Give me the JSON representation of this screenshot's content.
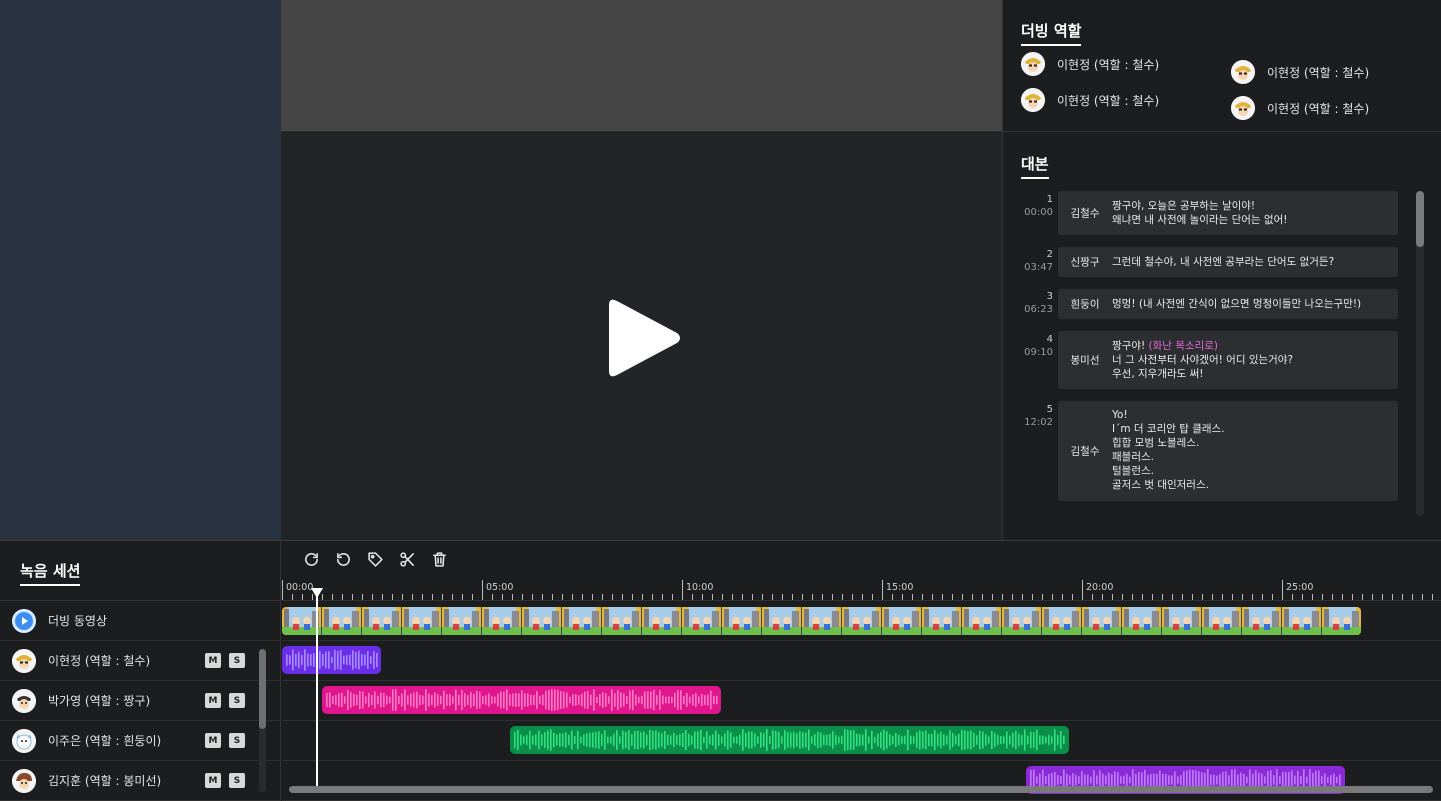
{
  "roles_panel": {
    "title": "더빙 역할",
    "items": [
      {
        "label": "이현정 (역할 : 철수)"
      },
      {
        "label": "이현정 (역할 : 철수)"
      },
      {
        "label": "이현정 (역할 : 철수)"
      },
      {
        "label": "이현정 (역할 : 철수)"
      }
    ]
  },
  "script_panel": {
    "title": "대본",
    "rows": [
      {
        "index": "1",
        "time": "00:00",
        "speaker": "김철수",
        "lines": "짱구야, 오늘은 공부하는 날이야!\n왜냐면 내 사전에 놀이라는 단어는 없어!"
      },
      {
        "index": "2",
        "time": "03:47",
        "speaker": "신짱구",
        "lines": "그런데 철수야, 내 사전엔 공부라는 단어도 없거든?"
      },
      {
        "index": "3",
        "time": "06:23",
        "speaker": "흰둥이",
        "lines": "멍멍! (내 사전엔 간식이 없으면 멍청이들만 나오는구만!)"
      },
      {
        "index": "4",
        "time": "09:10",
        "speaker": "봉미선",
        "line1": "짱구야! ",
        "highlight": "(화난 목소리로)",
        "lines": "너 그 사전부터 사야겠어! 어디 있는거야?\n우선, 지우개라도 써!"
      },
      {
        "index": "5",
        "time": "12:02",
        "speaker": "김철수",
        "lines": "Yo!\nI´m 더 코리안 탑 클래스.\n힙합 모범 노블레스.\n패블러스.\n털블런스.\n골저스 벗 대인저러스."
      }
    ]
  },
  "session": {
    "title": "녹음 세션",
    "tracks": [
      {
        "label": "더빙 동영상"
      },
      {
        "label": "이현정 (역할 : 철수)",
        "mute": "M",
        "solo": "S"
      },
      {
        "label": "박가영 (역할 : 짱구)",
        "mute": "M",
        "solo": "S"
      },
      {
        "label": "이주은 (역할 : 흰둥이)",
        "mute": "M",
        "solo": "S"
      },
      {
        "label": "김지훈 (역할 : 봉미선)",
        "mute": "M",
        "solo": "S"
      }
    ]
  },
  "toolbar": {
    "icons": [
      "redo-icon",
      "undo-icon",
      "tag-icon",
      "scissors-icon",
      "trash-icon"
    ]
  },
  "ruler": {
    "labels": [
      "00:00",
      "05:00",
      "10:00",
      "15:00",
      "20:00",
      "25:00"
    ]
  },
  "colors": {
    "track_purple": "#6a2ee8",
    "track_pink": "#e0168f",
    "track_green": "#10b05a",
    "track_violet": "#8a2ad6",
    "accent_blue": "#3d8ef0"
  }
}
